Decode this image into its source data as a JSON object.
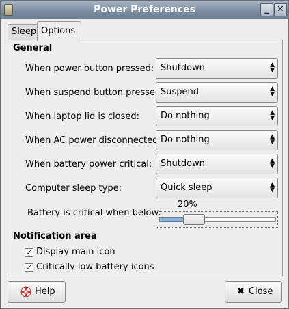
{
  "window": {
    "title": "Power Preferences",
    "minimize_icon": "minimize-icon",
    "close_icon": "close-icon"
  },
  "tabs": [
    {
      "label": "Sleep"
    },
    {
      "label": "Options",
      "active": true
    }
  ],
  "general": {
    "heading": "General",
    "rows": [
      {
        "label": "When power button pressed:",
        "value": "Shutdown"
      },
      {
        "label": "When suspend button pressed:",
        "value": "Suspend"
      },
      {
        "label": "When laptop lid is closed:",
        "value": "Do nothing"
      },
      {
        "label": "When AC power disconnected:",
        "value": "Do nothing"
      },
      {
        "label": "When battery power critical:",
        "value": "Shutdown"
      },
      {
        "label": "Computer sleep type:",
        "value": "Quick sleep"
      }
    ],
    "critical": {
      "label": "Battery is critical when below:",
      "value_text": "20%",
      "fraction": 0.2
    }
  },
  "notification": {
    "heading": "Notification area",
    "items": [
      {
        "label": "Display main icon",
        "checked": true
      },
      {
        "label": "Critically low battery icons",
        "checked": true
      }
    ]
  },
  "buttons": {
    "help": "Help",
    "close": "Close"
  },
  "colors": {
    "titlebar": "#7d8ea3",
    "slider_fill": "#8fb0d6"
  }
}
